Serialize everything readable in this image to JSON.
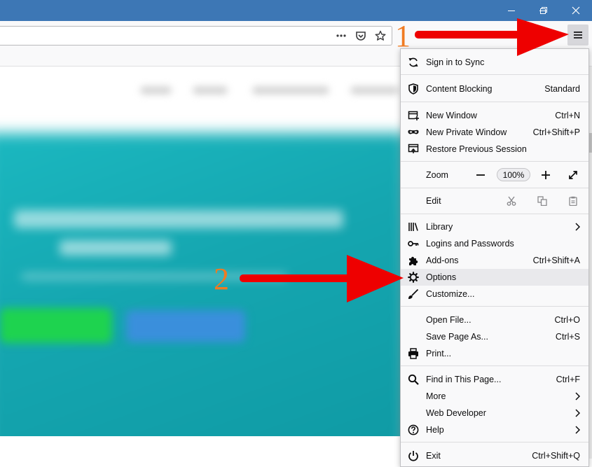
{
  "window": {
    "accent": "#3d77b5",
    "controls": [
      {
        "name": "minimize",
        "icon": "minimize-icon"
      },
      {
        "name": "restore",
        "icon": "restore-icon"
      },
      {
        "name": "close",
        "icon": "close-icon"
      }
    ]
  },
  "urlbar": {
    "actions": [
      "more-actions-icon",
      "pocket-icon",
      "bookmark-star-icon"
    ]
  },
  "menu": {
    "sync": {
      "label": "Sign in to Sync",
      "icon": "sync-icon"
    },
    "content_blocking": {
      "label": "Content Blocking",
      "value": "Standard",
      "icon": "shield-icon"
    },
    "new_window": {
      "label": "New Window",
      "shortcut": "Ctrl+N"
    },
    "new_private_window": {
      "label": "New Private Window",
      "shortcut": "Ctrl+Shift+P"
    },
    "restore_session": {
      "label": "Restore Previous Session"
    },
    "zoom": {
      "label": "Zoom",
      "level": "100%"
    },
    "edit": {
      "label": "Edit"
    },
    "library": {
      "label": "Library"
    },
    "logins": {
      "label": "Logins and Passwords"
    },
    "addons": {
      "label": "Add-ons",
      "shortcut": "Ctrl+Shift+A"
    },
    "options": {
      "label": "Options"
    },
    "customize": {
      "label": "Customize..."
    },
    "open_file": {
      "label": "Open File...",
      "shortcut": "Ctrl+O"
    },
    "save_page": {
      "label": "Save Page As...",
      "shortcut": "Ctrl+S"
    },
    "print": {
      "label": "Print..."
    },
    "find": {
      "label": "Find in This Page...",
      "shortcut": "Ctrl+F"
    },
    "more": {
      "label": "More"
    },
    "web_developer": {
      "label": "Web Developer"
    },
    "help": {
      "label": "Help"
    },
    "exit": {
      "label": "Exit",
      "shortcut": "Ctrl+Shift+Q"
    }
  },
  "annotations": {
    "step1": "1",
    "step2": "2",
    "arrow_color": "#ee0000",
    "number_color": "#f07b22"
  }
}
